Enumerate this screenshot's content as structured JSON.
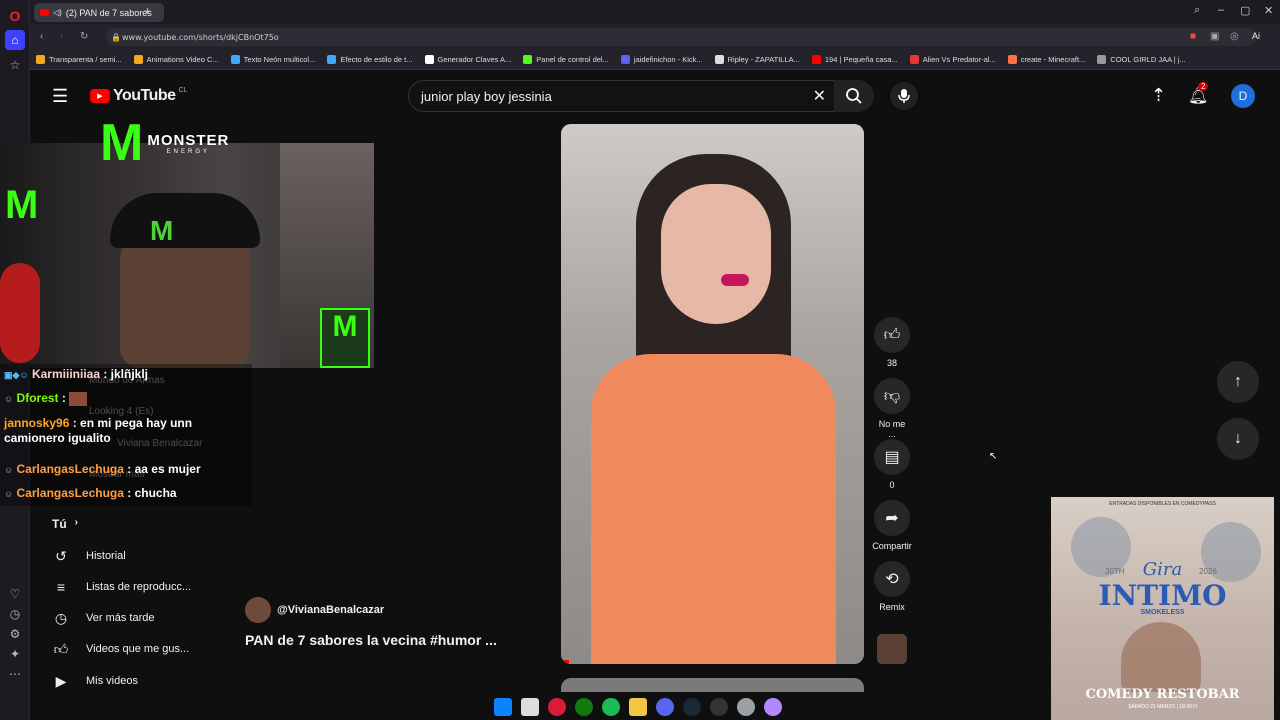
{
  "browser": {
    "tab_title": "(2) PAN de 7 sabores",
    "url": "www.youtube.com/shorts/dkjCBnOt75o",
    "ai_label": "Ai"
  },
  "bookmarks": [
    {
      "label": "Transparenta / semi..."
    },
    {
      "label": "Animations Video C..."
    },
    {
      "label": "Texto Neón multicol..."
    },
    {
      "label": "Efecto de estilo de t..."
    },
    {
      "label": "Generador Claves A..."
    },
    {
      "label": "Panel de control del..."
    },
    {
      "label": "jaidefinichon - Kick..."
    },
    {
      "label": "Ripley - ZAPATILLA..."
    },
    {
      "label": "194 | Pequeña casa..."
    },
    {
      "label": "Alien Vs Predator-al..."
    },
    {
      "label": "create - Minecraft..."
    },
    {
      "label": "COOL GIRLD JAA | j..."
    }
  ],
  "youtube": {
    "logo": "YouTube",
    "country": "CL",
    "search_query": "junior play boy jessinia",
    "notif_count": "2",
    "avatar_letter": "D"
  },
  "sidebar_hidden": {
    "mundo": "Mundo de Armas",
    "looking": "Looking 4 (Es)",
    "vivi": "Viviana Benalcazar",
    "mostrar": "Mostrar más"
  },
  "sidebar": {
    "section_title": "Tú",
    "items": [
      {
        "label": "Historial",
        "icon": "history-icon"
      },
      {
        "label": "Listas de reproducc...",
        "icon": "playlist-icon"
      },
      {
        "label": "Ver más tarde",
        "icon": "clock-icon"
      },
      {
        "label": "Videos que me gus...",
        "icon": "thumb-up-icon"
      },
      {
        "label": "Mis videos",
        "icon": "play-box-icon"
      }
    ]
  },
  "overlay_logo": {
    "brand": "MONSTER",
    "sub": "ENERGY"
  },
  "chat": [
    {
      "user": "Karmiiiniiaa",
      "msg": "jklñjklj",
      "color": "#ffd0d0"
    },
    {
      "user": "Dforest",
      "msg": "",
      "color": "#7cfc00"
    },
    {
      "user": "jannosky96",
      "msg": "en mi pega hay unn camionero igualito",
      "color": "#ffa726"
    },
    {
      "user": "CarlangasLechuga",
      "msg": "aa es mujer",
      "color": "#ff9f43"
    },
    {
      "user": "CarlangasLechuga",
      "msg": "chucha",
      "color": "#ff9f43"
    }
  ],
  "short": {
    "channel": "@VivianaBenalcazar",
    "title": "PAN de 7 sabores la vecina #humor ...",
    "likes": "38",
    "dislike_label": "No me ...",
    "comments": "0",
    "share_label": "Compartir",
    "remix_label": "Remix"
  },
  "poster": {
    "top_line": "ENTRADAS DISPONIBLES EN COMEDYPASS",
    "gira": "Gira",
    "title": "INTIMO",
    "sub": "SMOKELESS",
    "year_left": "30TH",
    "year_right": "2026",
    "venue": "COMEDY RESTOBAR",
    "date": "SÁBADO 21 MARZO | 18:00 H"
  }
}
